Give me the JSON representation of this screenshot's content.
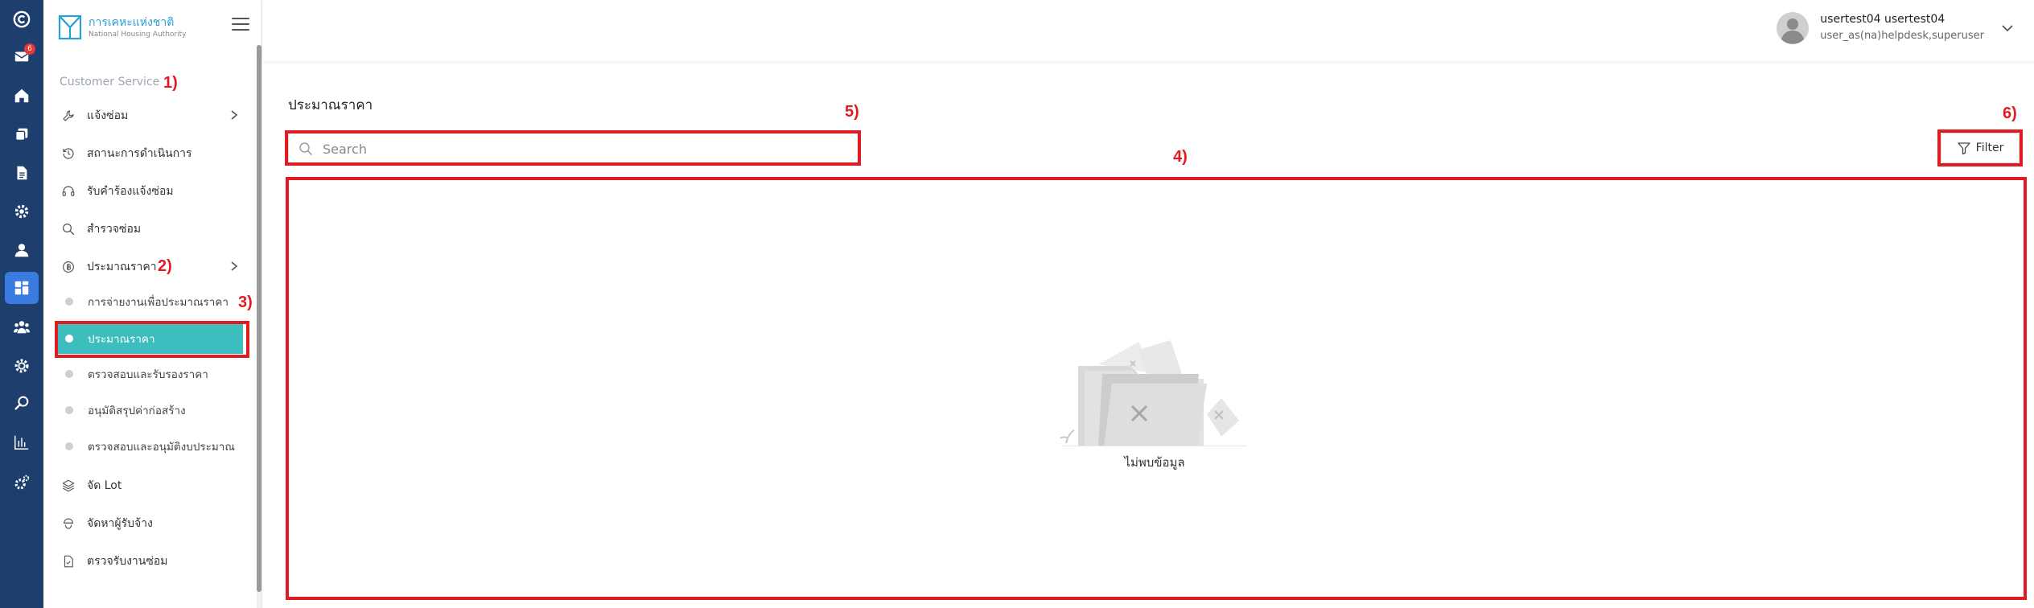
{
  "brand": {
    "name_th": "การเคหะแห่งชาติ",
    "name_en": "National Housing Authority"
  },
  "rail": {
    "mail_badge": "6",
    "items": [
      "logo-icon",
      "mail-icon",
      "home-icon",
      "copy-icon",
      "document-icon",
      "settings-icon",
      "user-icon",
      "dashboard-icon",
      "team-icon",
      "gear-icon",
      "search-icon",
      "chart-icon",
      "tools-icon"
    ],
    "active_item": "dashboard-icon",
    "accent": "#3a7be0",
    "background": "#1e3f6e"
  },
  "sidebar": {
    "section_label": "Customer Service",
    "menu": [
      {
        "label": "แจ้งซ่อม",
        "icon": "wrench-icon",
        "has_chevron": true
      },
      {
        "label": "สถานะการดำเนินการ",
        "icon": "history-icon",
        "has_chevron": false
      },
      {
        "label": "รับคำร้องแจ้งซ่อม",
        "icon": "headset-icon",
        "has_chevron": false
      },
      {
        "label": "สำรวจซ่อม",
        "icon": "search-icon",
        "has_chevron": false
      },
      {
        "label": "ประมาณราคา",
        "icon": "coin-icon",
        "has_chevron": true
      }
    ],
    "submenu": [
      {
        "label": "การจ่ายงานเพื่อประมาณราคา",
        "active": false
      },
      {
        "label": "ประมาณราคา",
        "active": true
      },
      {
        "label": "ตรวจสอบและรับรองราคา",
        "active": false
      },
      {
        "label": "อนุมัติสรุปค่าก่อสร้าง",
        "active": false
      },
      {
        "label": "ตรวจสอบและอนุมัติงบประมาณ",
        "active": false
      }
    ],
    "menu_bottom": [
      {
        "label": "จัด Lot",
        "icon": "layers-icon"
      },
      {
        "label": "จัดหาผู้รับจ้าง",
        "icon": "worker-icon"
      },
      {
        "label": "ตรวจรับงานซ่อม",
        "icon": "file-check-icon"
      }
    ],
    "active_color": "#3dbdbd"
  },
  "header": {
    "user_name": "usertest04 usertest04",
    "user_role": "user_as(na)helpdesk,superuser"
  },
  "main": {
    "title": "ประมาณราคา",
    "search_placeholder": "Search",
    "filter_label": "Filter",
    "empty_text": "ไม่พบข้อมูล"
  },
  "annotations": {
    "color": "#e11b22",
    "labels": [
      "1)",
      "2)",
      "3)",
      "4)",
      "5)",
      "6)"
    ]
  }
}
